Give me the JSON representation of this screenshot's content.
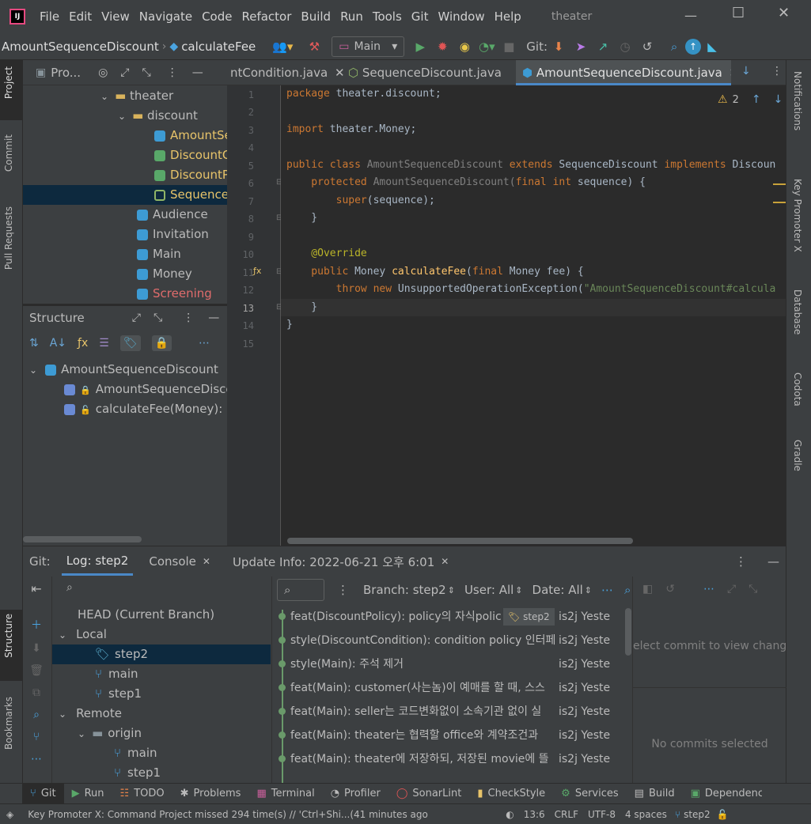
{
  "app": {
    "logo": "IJ",
    "menu": [
      "File",
      "Edit",
      "View",
      "Navigate",
      "Code",
      "Refactor",
      "Build",
      "Run",
      "Tools",
      "Git",
      "Window",
      "Help"
    ],
    "project_name": "theater"
  },
  "toolbar": {
    "breadcrumb": [
      "AmountSequenceDiscount",
      "calculateFee"
    ],
    "run_config": "Main",
    "git_label": "Git:"
  },
  "left_strip": {
    "project": "Project",
    "commit": "Commit",
    "pull_requests": "Pull Requests",
    "structure": "Structure",
    "bookmarks": "Bookmarks"
  },
  "right_strip": {
    "notifications": "Notifications",
    "key_promoter": "Key Promoter X",
    "database": "Database",
    "codota": "Codota",
    "gradle": "Gradle"
  },
  "project_panel": {
    "title": "Pro...",
    "items": [
      {
        "label": "theater",
        "kind": "folder"
      },
      {
        "label": "discount",
        "kind": "folder"
      },
      {
        "label": "AmountSe",
        "kind": "class"
      },
      {
        "label": "DiscountC",
        "kind": "interface"
      },
      {
        "label": "DiscountP",
        "kind": "interface"
      },
      {
        "label": "SequenceI",
        "kind": "abstract"
      },
      {
        "label": "Audience",
        "kind": "class"
      },
      {
        "label": "Invitation",
        "kind": "class"
      },
      {
        "label": "Main",
        "kind": "class"
      },
      {
        "label": "Money",
        "kind": "class"
      },
      {
        "label": "Screening",
        "kind": "class"
      }
    ]
  },
  "structure_panel": {
    "title": "Structure",
    "items": [
      "AmountSequenceDiscount",
      "AmountSequenceDiscou",
      "calculateFee(Money): M"
    ]
  },
  "editor_tabs": [
    {
      "label": "ntCondition.java"
    },
    {
      "label": "SequenceDiscount.java"
    },
    {
      "label": "AmountSequenceDiscount.java"
    }
  ],
  "editor": {
    "warnings": "2",
    "line_numbers": [
      "1",
      "2",
      "3",
      "4",
      "5",
      "6",
      "7",
      "8",
      "9",
      "10",
      "11",
      "12",
      "13",
      "14",
      "15"
    ],
    "code": {
      "l1a": "package",
      "l1b": " theater.discount;",
      "l3a": "import",
      "l3b": " theater.Money;",
      "l5a": "public class",
      "l5b": " AmountSequenceDiscount ",
      "l5c": "extends",
      "l5d": " SequenceDiscount ",
      "l5e": "implements",
      "l5f": " Discoun",
      "l6a": "    protected",
      "l6b": " AmountSequenceDiscount(",
      "l6c": "final int",
      "l6d": " sequence) {",
      "l7a": "        super",
      "l7b": "(sequence);",
      "l8": "    }",
      "l10": "    @Override",
      "l11a": "    public",
      "l11b": " Money ",
      "l11c": "calculateFee",
      "l11d": "(",
      "l11e": "final",
      "l11f": " Money fee) {",
      "l12a": "        throw new",
      "l12b": " UnsupportedOperationException(",
      "l12c": "\"AmountSequenceDiscount#calcula",
      "l13": "    }",
      "l14": "}"
    }
  },
  "bottom": {
    "tabs": {
      "git": "Git:",
      "log": "Log: step2",
      "console": "Console",
      "update": "Update Info: 2022-06-21 오후 6:01"
    },
    "filters": {
      "branch": "Branch: step2",
      "user": "User: All",
      "date": "Date: All"
    },
    "branches": {
      "head": "HEAD (Current Branch)",
      "local": "Local",
      "local_items": [
        "step2",
        "main",
        "step1"
      ],
      "remote": "Remote",
      "origin": "origin",
      "origin_items": [
        "main",
        "step1"
      ]
    },
    "commits": [
      {
        "msg": "feat(DiscountPolicy): policy의 자식polic",
        "tag": "step2",
        "author": "is2j Yeste"
      },
      {
        "msg": "style(DiscountCondition): condition policy 인터페",
        "author": "is2j Yeste"
      },
      {
        "msg": "style(Main): 주석 제거",
        "author": "is2j Yeste"
      },
      {
        "msg": "feat(Main): customer(사는놈)이 예매를 할 때, 스스",
        "author": "is2j Yeste"
      },
      {
        "msg": "feat(Main): seller는 코드변화없이 소속기관 없이 실",
        "author": "is2j Yeste"
      },
      {
        "msg": "feat(Main): theater는 협력할 office와 계약조건과",
        "author": "is2j Yeste"
      },
      {
        "msg": "feat(Main): theater에 저장하되, 저장된 movie에 뜰",
        "author": "is2j Yeste"
      }
    ],
    "details_hint": "elect commit to view change",
    "no_commits": "No commits selected"
  },
  "toolstrip": [
    "Git",
    "Run",
    "TODO",
    "Problems",
    "Terminal",
    "Profiler",
    "SonarLint",
    "CheckStyle",
    "Services",
    "Build",
    "Dependencie"
  ],
  "status": {
    "message": "Key Promoter X: Command Project missed 294 time(s) // 'Ctrl+Shi...(41 minutes ago",
    "position": "13:6",
    "line_sep": "CRLF",
    "encoding": "UTF-8",
    "indent": "4 spaces",
    "branch": "step2"
  }
}
